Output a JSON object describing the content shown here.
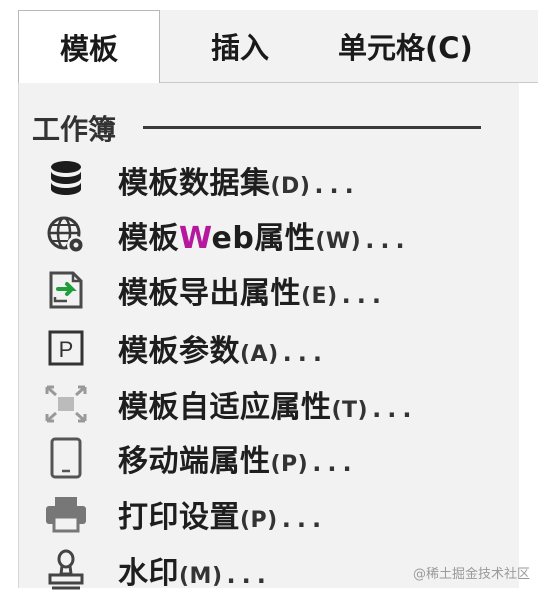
{
  "tabs": [
    {
      "label": "模板"
    },
    {
      "label": "插入"
    },
    {
      "label": "单元格(C)"
    }
  ],
  "section": {
    "title": "工作簿"
  },
  "items": [
    {
      "icon": "database-icon",
      "label": "模板数据集",
      "shortcut": "(D)",
      "dots": "..."
    },
    {
      "icon": "globe-gear-icon",
      "label_prefix": "模板",
      "label_accent": "W",
      "label_rest": "eb属性",
      "shortcut": "(W)",
      "dots": "..."
    },
    {
      "icon": "export-icon",
      "label": "模板导出属性",
      "shortcut": "(E)",
      "dots": "..."
    },
    {
      "icon": "parameter-icon",
      "label": "模板参数",
      "shortcut": "(A)",
      "dots": "..."
    },
    {
      "icon": "fit-screen-icon",
      "label": "模板自适应属性",
      "shortcut": "(T)",
      "dots": "..."
    },
    {
      "icon": "tablet-icon",
      "label": "移动端属性",
      "shortcut": "(P)",
      "dots": "..."
    },
    {
      "icon": "printer-icon",
      "label": "打印设置",
      "shortcut": "(P)",
      "dots": "..."
    },
    {
      "icon": "stamp-icon",
      "label": "水印",
      "shortcut": "(M)",
      "dots": "..."
    }
  ],
  "watermark": "@稀土掘金技术社区"
}
